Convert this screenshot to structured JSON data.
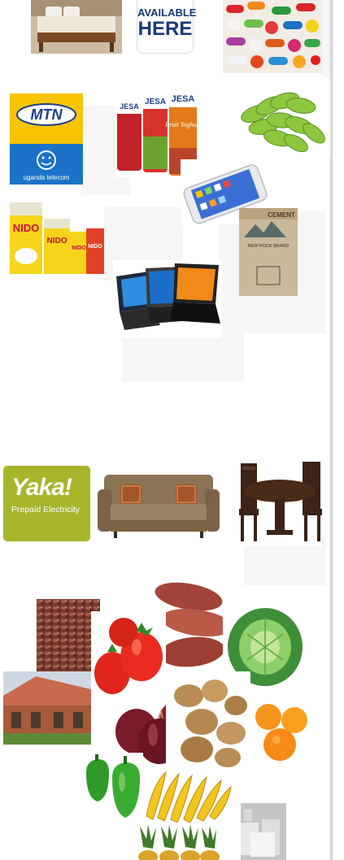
{
  "badge": {
    "line1": "AVAILABLE",
    "line2": "HERE"
  },
  "mtn": {
    "brand": "MTN",
    "subline": "uganda telecom"
  },
  "yogurt": {
    "brand": "JESA",
    "flavor_text": "Fruit Yoghurt"
  },
  "milk": {
    "brand": "NIDO"
  },
  "cement": {
    "label": "CEMENT",
    "brand": "NEW ROCK BRAND"
  },
  "yaka": {
    "brand": "Yaka!",
    "tagline": "Prepaid Electricity"
  },
  "tiles": [
    {
      "name": "bed-image"
    },
    {
      "name": "medicine-pills-image"
    },
    {
      "name": "green-bananas-image"
    },
    {
      "name": "smartphone-image"
    },
    {
      "name": "laptops-image"
    },
    {
      "name": "sofa-image"
    },
    {
      "name": "dining-set-image"
    },
    {
      "name": "beans-image"
    },
    {
      "name": "house-image"
    },
    {
      "name": "sweet-potatoes-image"
    },
    {
      "name": "tomatoes-image"
    },
    {
      "name": "cabbage-image"
    },
    {
      "name": "onions-image"
    },
    {
      "name": "irish-potatoes-image"
    },
    {
      "name": "oranges-image"
    },
    {
      "name": "green-peppers-image"
    },
    {
      "name": "ripe-bananas-image"
    },
    {
      "name": "pineapples-image"
    },
    {
      "name": "bags-image"
    }
  ],
  "colors": {
    "mtn_yellow": "#f6c400",
    "mtn_blue": "#1b3f8c",
    "yaka_green": "#a8b42a",
    "badge_blue": "#173a78"
  }
}
